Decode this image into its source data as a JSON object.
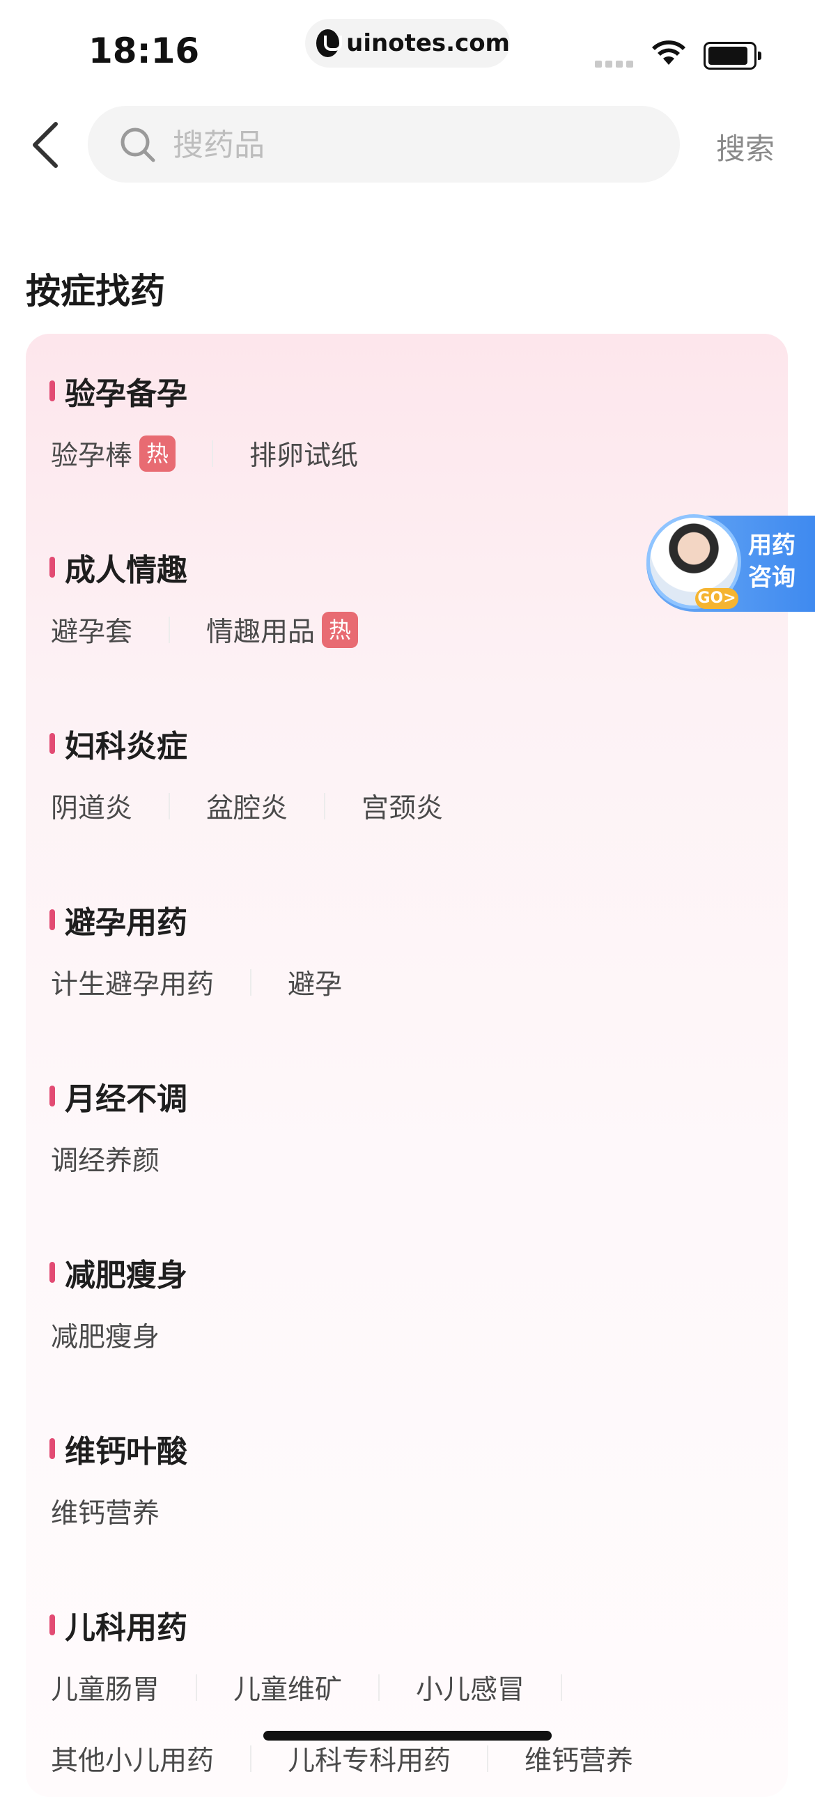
{
  "status_bar": {
    "time": "18:16",
    "url": "uinotes.com"
  },
  "search": {
    "placeholder": "搜药品",
    "button": "搜索"
  },
  "section_title": "按症找药",
  "hot_badge": "热",
  "groups": [
    {
      "title": "验孕备孕",
      "tags": [
        {
          "label": "验孕棒",
          "hot": true
        },
        {
          "label": "排卵试纸"
        }
      ]
    },
    {
      "title": "成人情趣",
      "tags": [
        {
          "label": "避孕套"
        },
        {
          "label": "情趣用品",
          "hot": true
        }
      ]
    },
    {
      "title": "妇科炎症",
      "tags": [
        {
          "label": "阴道炎"
        },
        {
          "label": "盆腔炎"
        },
        {
          "label": "宫颈炎"
        }
      ]
    },
    {
      "title": "避孕用药",
      "tags": [
        {
          "label": "计生避孕用药"
        },
        {
          "label": "避孕"
        }
      ]
    },
    {
      "title": "月经不调",
      "tags": [
        {
          "label": "调经养颜"
        }
      ]
    },
    {
      "title": "减肥瘦身",
      "tags": [
        {
          "label": "减肥瘦身"
        }
      ]
    },
    {
      "title": "维钙叶酸",
      "tags": [
        {
          "label": "维钙营养"
        }
      ]
    },
    {
      "title": "儿科用药",
      "tags": [
        {
          "label": "儿童肠胃"
        },
        {
          "label": "儿童维矿"
        },
        {
          "label": "小儿感冒"
        }
      ],
      "tags_row2": [
        {
          "label": "其他小儿用药"
        },
        {
          "label": "儿科专科用药"
        },
        {
          "label": "维钙营养"
        }
      ]
    }
  ],
  "consult": {
    "label_line1": "用药",
    "label_line2": "咨询",
    "go": "GO>"
  }
}
